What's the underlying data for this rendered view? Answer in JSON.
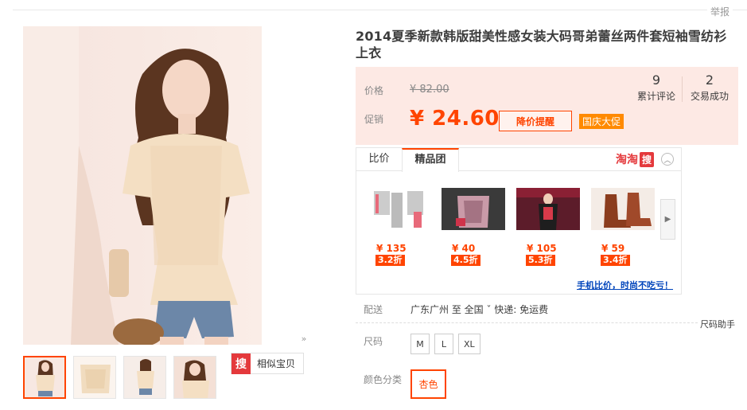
{
  "report": "举报",
  "title": "2014夏季新款韩版甜美性感女装大码哥弟蕾丝两件套短袖雪纺衫上衣",
  "price": {
    "label": "价格",
    "original": "¥ 82.00",
    "promo_label": "促销",
    "promo": "¥ 24.60",
    "alert_button": "降价提醒",
    "festival_tag": "国庆大促"
  },
  "stats": {
    "reviews_num": "9",
    "reviews_label": "累计评论",
    "sales_num": "2",
    "sales_label": "交易成功"
  },
  "compare": {
    "tabs": [
      "比价",
      "精品团"
    ],
    "brand": "淘淘",
    "brand_box": "搜",
    "products": [
      {
        "price": "¥ 135",
        "discount": "3.2折"
      },
      {
        "price": "¥ 40",
        "discount": "4.5折"
      },
      {
        "price": "¥ 105",
        "discount": "5.3折"
      },
      {
        "price": "¥ 59",
        "discount": "3.4折"
      }
    ],
    "mobile_link": "手机比价，时尚不吃亏！"
  },
  "similar": {
    "icon_text": "搜",
    "label": "相似宝贝"
  },
  "shipping": {
    "label": "配送",
    "text": "广东广州  至  全国 ˇ  快递: 免运费"
  },
  "size": {
    "label": "尺码",
    "options": [
      "M",
      "L",
      "XL"
    ],
    "help": "尺码助手"
  },
  "color": {
    "label": "颜色分类",
    "selected": "杏色"
  },
  "colors": {
    "accent": "#ff4400",
    "price_bg": "#fde9e4",
    "festival": "#ff8a00",
    "link": "#0044bb"
  }
}
